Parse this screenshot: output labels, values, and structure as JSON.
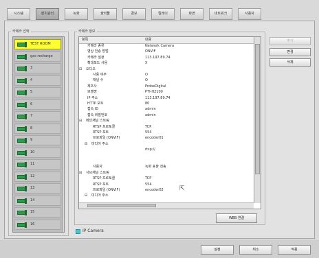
{
  "tabs": [
    {
      "label": "시스템",
      "active": false
    },
    {
      "label": "장치관리",
      "active": true
    },
    {
      "label": "녹화",
      "active": false
    },
    {
      "label": "출력물",
      "active": false
    },
    {
      "label": "경보",
      "active": false
    },
    {
      "label": "릴레이",
      "active": false
    },
    {
      "label": "화면",
      "active": false
    },
    {
      "label": "네트워크",
      "active": false
    },
    {
      "label": "사용자",
      "active": false
    }
  ],
  "camera_select": {
    "title": "카메라 선택",
    "items": [
      {
        "label": "TEST ROOM",
        "selected": true
      },
      {
        "label": "gas recharge",
        "selected": false
      },
      {
        "label": "3",
        "selected": false
      },
      {
        "label": "4",
        "selected": false
      },
      {
        "label": "5",
        "selected": false
      },
      {
        "label": "6",
        "selected": false
      },
      {
        "label": "7",
        "selected": false
      },
      {
        "label": "8",
        "selected": false
      },
      {
        "label": "9",
        "selected": false
      },
      {
        "label": "10",
        "selected": false
      },
      {
        "label": "11",
        "selected": false
      },
      {
        "label": "12",
        "selected": false
      },
      {
        "label": "13",
        "selected": false
      },
      {
        "label": "14",
        "selected": false
      },
      {
        "label": "15",
        "selected": false
      },
      {
        "label": "16",
        "selected": false
      }
    ]
  },
  "camera_info": {
    "title": "카메라 정보",
    "col_item": "항목",
    "col_value": "내용",
    "rows": [
      {
        "key": "카메라 종류",
        "value": "Network Camera",
        "level": 1
      },
      {
        "key": "영상 전송 방법",
        "value": "ONVIF",
        "level": 1
      },
      {
        "key": "카메라 설정",
        "value": "113.197.89.74",
        "level": 1
      },
      {
        "key": "확대모드 사용",
        "value": "X",
        "level": 1
      },
      {
        "key": "오디오",
        "value": "",
        "level": 0,
        "expander": "⊟"
      },
      {
        "key": "사용 여부",
        "value": "O",
        "level": 2
      },
      {
        "key": "채널 수",
        "value": "O",
        "level": 2
      },
      {
        "key": "제조사",
        "value": "ProbeDigital",
        "level": 1
      },
      {
        "key": "모델명",
        "value": "PTI-H2100",
        "level": 1
      },
      {
        "key": "IP 주소",
        "value": "113.197.89.74",
        "level": 1
      },
      {
        "key": "HTTP 포트",
        "value": "80",
        "level": 1
      },
      {
        "key": "접속 ID",
        "value": "admin",
        "level": 1
      },
      {
        "key": "접속 비밀번호",
        "value": "admin",
        "level": 1
      },
      {
        "key": "메인채널 스트림",
        "value": "",
        "level": 0,
        "expander": "⊟"
      },
      {
        "key": "RTSP 프로토콜",
        "value": "TCP",
        "level": 2
      },
      {
        "key": "RTSP 포트",
        "value": "554",
        "level": 2
      },
      {
        "key": "프로파일 (ONVIF)",
        "value": "encoder01",
        "level": 2
      },
      {
        "key": "미디어 주소",
        "value": "",
        "level": 1,
        "expander": "⊟"
      },
      {
        "key": "",
        "value": "rtsp://",
        "level": 3
      },
      {
        "key": "",
        "value": "",
        "level": 3
      },
      {
        "key": "",
        "value": "",
        "level": 3
      },
      {
        "key": "사용자",
        "value": "녹화 표출 전송",
        "level": 2
      },
      {
        "key": "서브채널 스트림",
        "value": "",
        "level": 0,
        "expander": "⊟"
      },
      {
        "key": "RTSP 프로토콜",
        "value": "TCP",
        "level": 2
      },
      {
        "key": "RTSP 포트",
        "value": "554",
        "level": 2
      },
      {
        "key": "프로파일 (ONVIF)",
        "value": "encoder02",
        "level": 2
      },
      {
        "key": "미디어 주소",
        "value": "",
        "level": 1,
        "expander": "⊟"
      }
    ]
  },
  "side_buttons": {
    "add": "추가",
    "change": "변경",
    "delete": "삭제"
  },
  "web_connect": "WEB 연결",
  "ip_camera_checkbox": {
    "label": "IP Camera",
    "checked": true
  },
  "footer_buttons": {
    "apply": "설정",
    "cancel": "취소",
    "ok": "적용"
  }
}
